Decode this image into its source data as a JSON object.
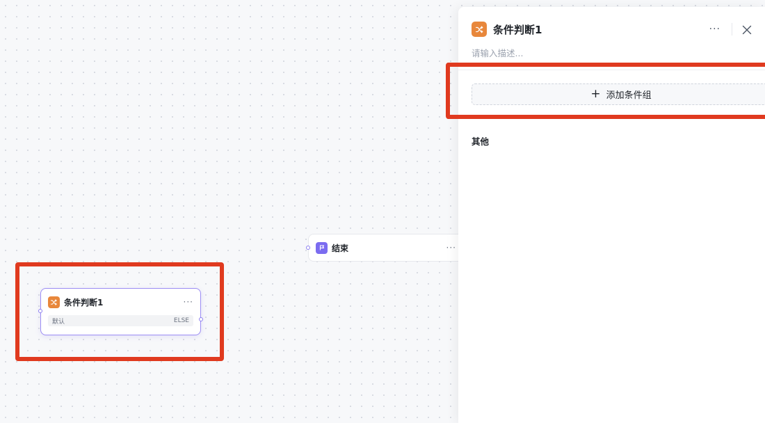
{
  "canvas": {
    "end_node": {
      "title": "结束",
      "more": "···"
    },
    "condition_node": {
      "title": "条件判断1",
      "more": "···",
      "else_row": {
        "label": "默认",
        "value": "ELSE"
      }
    }
  },
  "panel": {
    "title": "条件判断1",
    "description_placeholder": "请输入描述...",
    "more": "···",
    "add_condition_group_label": "添加条件组",
    "others_label": "其他"
  },
  "colors": {
    "condition_icon": "#e8873b",
    "end_icon": "#7b6cf0",
    "highlight": "#e03a1f",
    "selected_border": "#9b8cf3"
  },
  "icons": {
    "condition": "shuffle-icon",
    "end": "flag-icon",
    "close": "close-icon",
    "add": "plus-icon"
  }
}
